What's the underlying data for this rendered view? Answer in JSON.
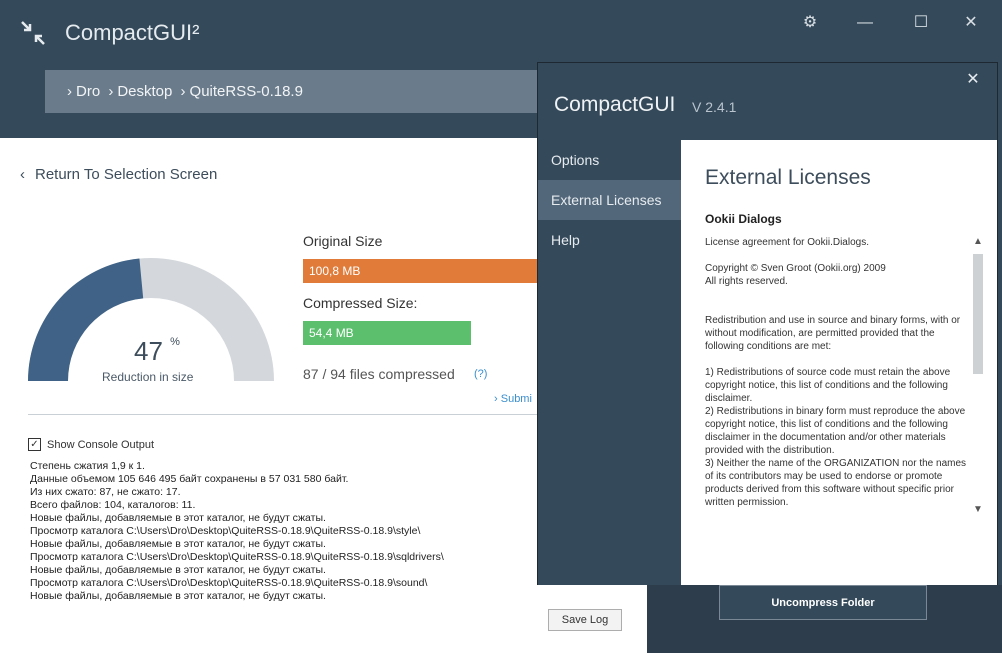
{
  "app": {
    "title": "CompactGUI²"
  },
  "breadcrumb": [
    "Dro",
    "Desktop",
    "QuiteRSS-0.18.9"
  ],
  "main": {
    "back_label": "Return To Selection Screen",
    "percent": "47",
    "percent_unit": "%",
    "reduction_label": "Reduction in size",
    "gauge_fraction": 0.47,
    "original_label": "Original Size",
    "original_value": "100,8 MB",
    "compressed_label": "Compressed Size:",
    "compressed_value": "54,4 MB",
    "files_text": "87 / 94 files compressed",
    "help_label": "(?)",
    "submit_label": "Submi",
    "show_console_label": "Show Console Output",
    "show_console_checked": true,
    "console_lines": [
      "Степень сжатия 1,9 к 1.",
      "Данные объемом 105 646 495 байт сохранены в 57 031 580 байт.",
      "Из них сжато: 87, не сжато: 17.",
      "Всего файлов: 104, каталогов: 11.",
      " Новые файлы, добавляемые в этот каталог, не будут сжаты.",
      " Просмотр каталога C:\\Users\\Dro\\Desktop\\QuiteRSS-0.18.9\\QuiteRSS-0.18.9\\style\\",
      " Новые файлы, добавляемые в этот каталог, не будут сжаты.",
      " Просмотр каталога C:\\Users\\Dro\\Desktop\\QuiteRSS-0.18.9\\QuiteRSS-0.18.9\\sqldrivers\\",
      " Новые файлы, добавляемые в этот каталог, не будут сжаты.",
      " Просмотр каталога C:\\Users\\Dro\\Desktop\\QuiteRSS-0.18.9\\QuiteRSS-0.18.9\\sound\\",
      " Новые файлы, добавляемые в этот каталог, не будут сжаты."
    ],
    "save_log_label": "Save Log",
    "uncompress_label": "Uncompress Folder"
  },
  "dialog": {
    "title": "CompactGUI",
    "version": "V 2.4.1",
    "nav": [
      "Options",
      "External Licenses",
      "Help"
    ],
    "selected": "External Licenses",
    "heading": "External Licenses",
    "subheading": "Ookii Dialogs",
    "license_text": "License agreement for Ookii.Dialogs.\n\nCopyright © Sven Groot (Ookii.org) 2009\nAll rights reserved.\n\n\nRedistribution and use in source and binary forms, with or without modification, are permitted provided that the following conditions are met:\n\n1) Redistributions of source code must retain the above copyright notice, this list of conditions and the following disclaimer.\n2) Redistributions in binary form must reproduce the above copyright notice, this list of conditions and the following disclaimer in the documentation and/or other materials provided with the distribution.\n3) Neither the name of the ORGANIZATION nor the names of its contributors may be used to endorse or promote products derived from this software without specific prior written permission."
  },
  "colors": {
    "orange": "#e07b39",
    "green": "#5bbf6e",
    "gauge_fill": "#3f6286",
    "gauge_bg": "#d4d8dc",
    "dark": "#34495a"
  }
}
